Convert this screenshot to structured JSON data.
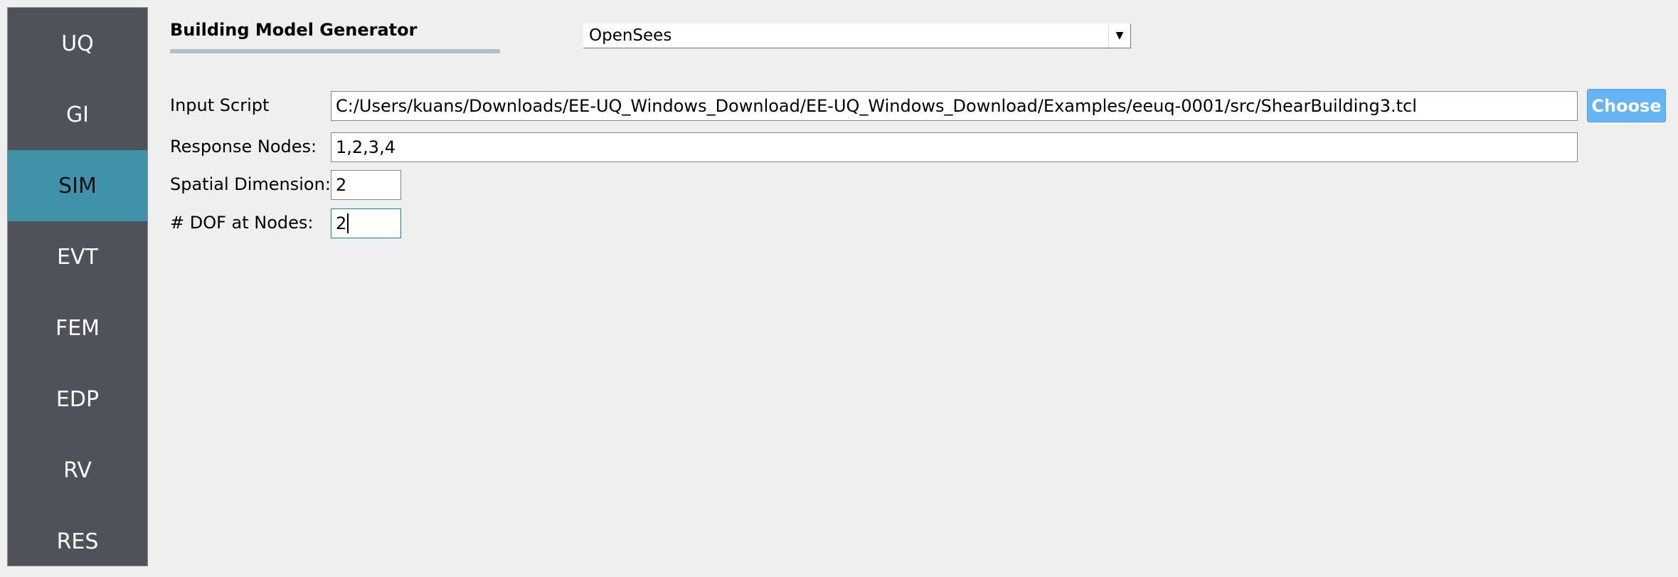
{
  "sidebar": {
    "items": [
      {
        "label": "UQ"
      },
      {
        "label": "GI"
      },
      {
        "label": "SIM",
        "active": true
      },
      {
        "label": "EVT"
      },
      {
        "label": "FEM"
      },
      {
        "label": "EDP"
      },
      {
        "label": "RV"
      },
      {
        "label": "RES"
      }
    ],
    "active_color": "#3f92a8"
  },
  "header": {
    "title": "Building Model Generator",
    "generator_selected": "OpenSees"
  },
  "form": {
    "input_script": {
      "label": "Input Script",
      "value": "C:/Users/kuans/Downloads/EE-UQ_Windows_Download/EE-UQ_Windows_Download/Examples/eeuq-0001/src/ShearBuilding3.tcl",
      "button": "Choose"
    },
    "response_nodes": {
      "label": "Response Nodes:",
      "value": "1,2,3,4"
    },
    "spatial_dimension": {
      "label": "Spatial Dimension:",
      "value": "2"
    },
    "dof_at_nodes": {
      "label": "# DOF at Nodes:",
      "value": "2"
    }
  }
}
